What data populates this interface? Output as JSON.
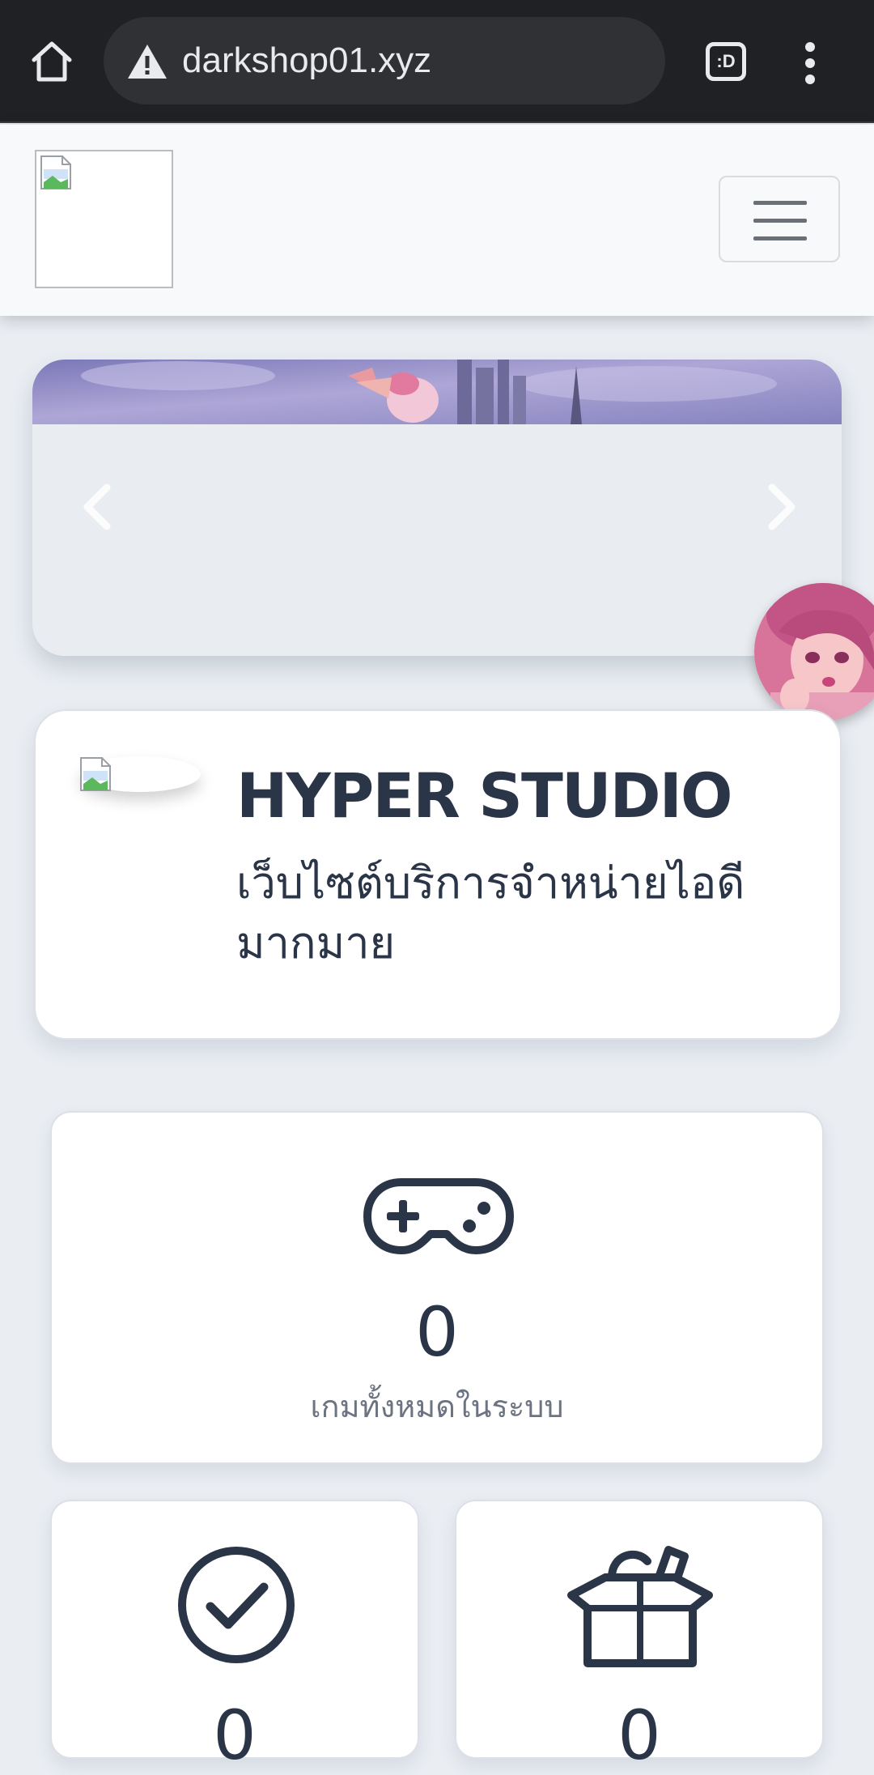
{
  "browser": {
    "url": "darkshop01.xyz",
    "tabs_icon_text": ":D"
  },
  "site": {
    "name": "HYPER STUDIO",
    "tagline": "เว็บไซต์บริการจำหน่ายไอดีมากมาย"
  },
  "stats": {
    "total_games": {
      "value": "0",
      "label": "เกมทั้งหมดในระบบ",
      "icon": "gamepad-icon"
    },
    "sold": {
      "value": "0",
      "icon": "check-circle-icon"
    },
    "stock": {
      "value": "0",
      "icon": "box-icon"
    }
  },
  "colors": {
    "browser_bg": "#202124",
    "page_bg": "#eaeef3",
    "text_dark": "#2b3548",
    "text_muted": "#6c7381"
  }
}
